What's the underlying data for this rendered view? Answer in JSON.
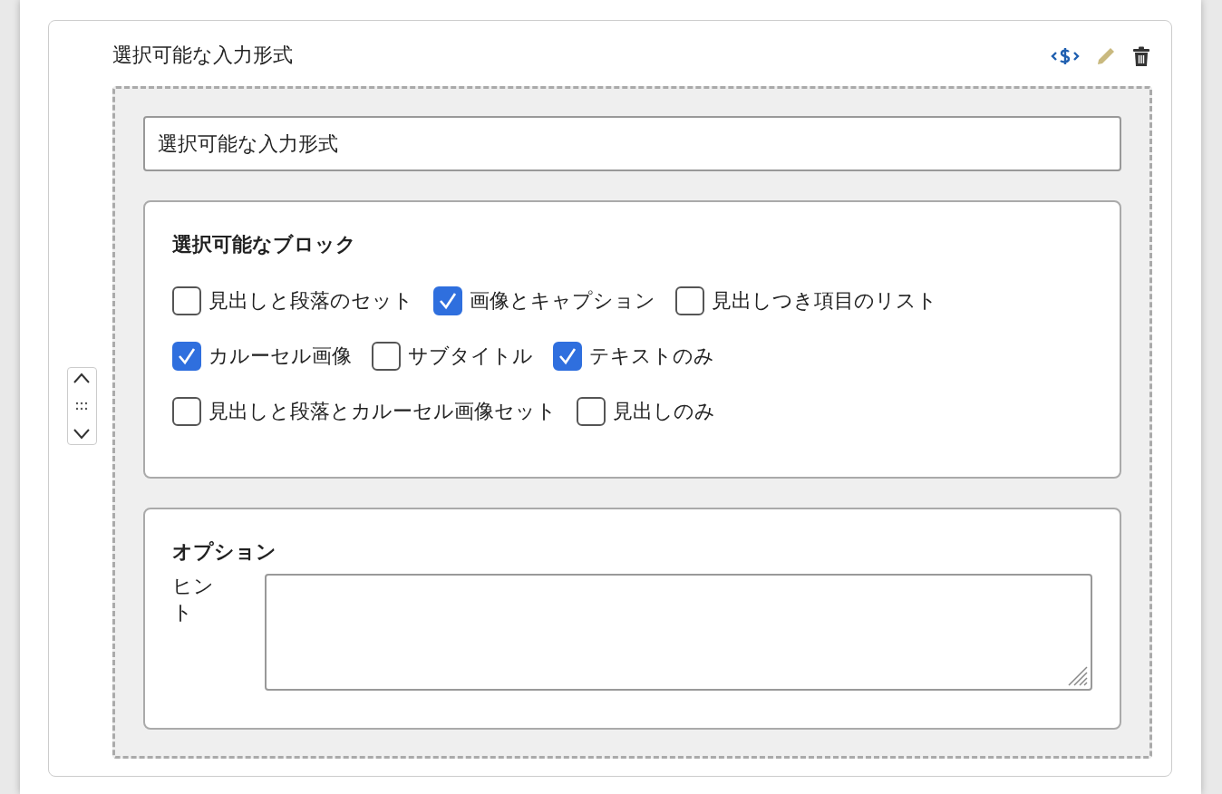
{
  "block": {
    "title": "選択可能な入力形式",
    "name_field": {
      "value": "選択可能な入力形式"
    },
    "selectable_blocks": {
      "heading": "選択可能なブロック",
      "options": [
        {
          "label": "見出しと段落のセット",
          "checked": false
        },
        {
          "label": "画像とキャプション",
          "checked": true
        },
        {
          "label": "見出しつき項目のリスト",
          "checked": false
        },
        {
          "label": "カルーセル画像",
          "checked": true
        },
        {
          "label": "サブタイトル",
          "checked": false
        },
        {
          "label": "テキストのみ",
          "checked": true
        },
        {
          "label": "見出しと段落とカルーセル画像セット",
          "checked": false
        },
        {
          "label": "見出しのみ",
          "checked": false
        }
      ]
    },
    "options": {
      "heading": "オプション",
      "hint": {
        "label": "ヒント"
      }
    }
  }
}
